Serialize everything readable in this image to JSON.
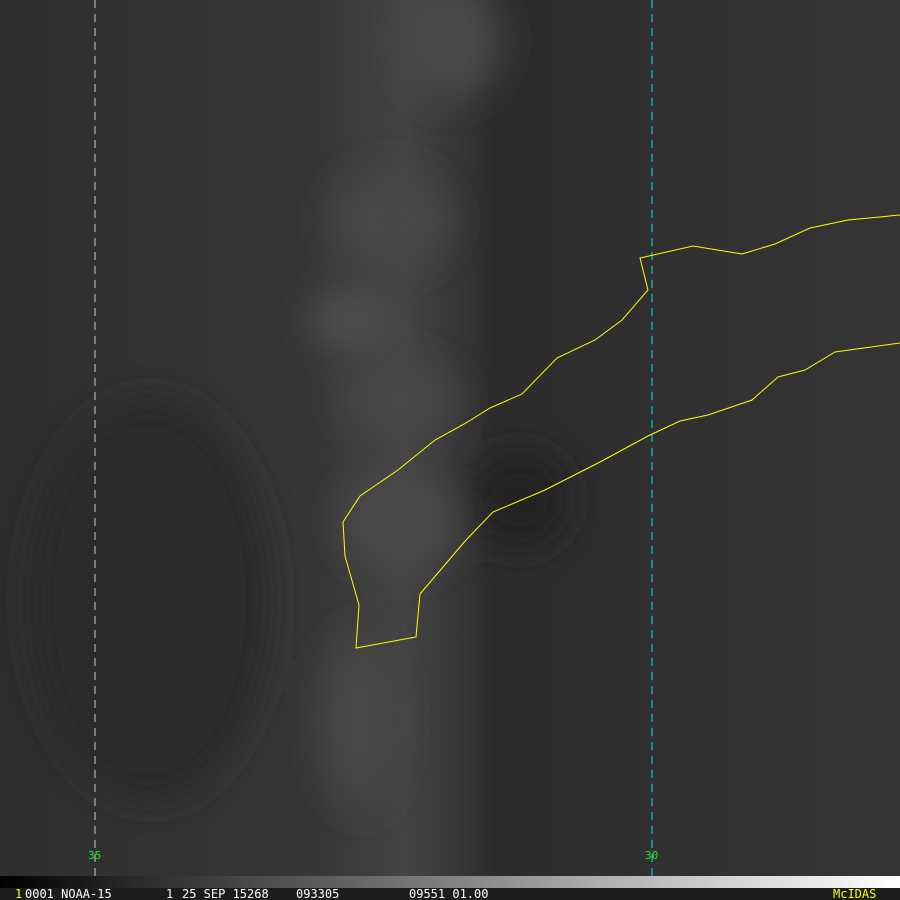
{
  "frame_number": "1",
  "satellite_line": "0001 NOAA-15",
  "band": "1",
  "date": "25 SEP 15268",
  "time": "093305",
  "extra": "09551 01.00",
  "brand": "McIDAS",
  "longitude_labels": [
    "35",
    "30"
  ],
  "colors": {
    "coastline": "#ffff00",
    "grid_line_left": "#cccccc",
    "grid_line_right": "#00e5ee",
    "label": "#22e622",
    "brand": "#ffff00"
  }
}
